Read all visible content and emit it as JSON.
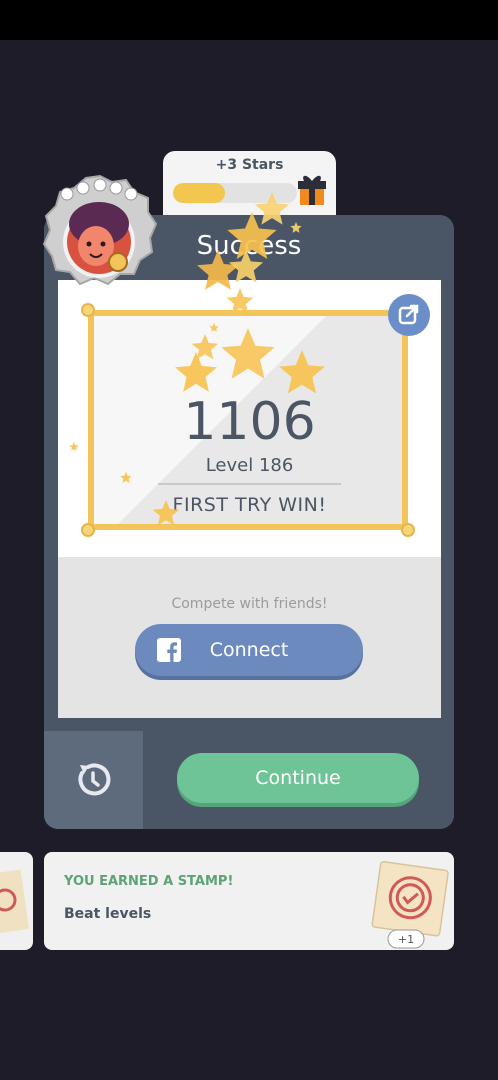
{
  "reward": {
    "label": "+3 Stars",
    "progress": 0.42
  },
  "card": {
    "title": "Success",
    "score": "1106",
    "level": "Level 186",
    "achievement": "FIRST TRY WIN!",
    "compete": "Compete with friends!",
    "connect_label": "Connect",
    "continue_label": "Continue"
  },
  "stamp": {
    "heading": "YOU EARNED A STAMP!",
    "subtitle": "Beat levels",
    "count": "+1"
  },
  "colors": {
    "background": "#1d1c28",
    "card": "#4a5666",
    "gold": "#f2c45a",
    "continue": "#6ec496",
    "facebook": "#6d8abf"
  },
  "icons": [
    "share-icon",
    "facebook-icon",
    "retry-icon",
    "gift-icon",
    "star-icon",
    "stamp-icon"
  ]
}
